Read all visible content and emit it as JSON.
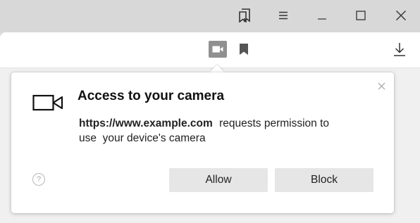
{
  "window": {
    "controls": [
      {
        "name": "bookmarks-panel-icon"
      },
      {
        "name": "menu-icon"
      },
      {
        "name": "minimize-icon"
      },
      {
        "name": "maximize-icon"
      },
      {
        "name": "close-window-icon"
      }
    ]
  },
  "toolbar": {
    "icons": [
      "camera-active-icon",
      "bookmark-icon",
      "download-icon"
    ]
  },
  "permission_popup": {
    "title": "Access to your camera",
    "site": "https://www.example.com",
    "message_line1": "requests permission to",
    "message_line2": "use  your device's camera",
    "help_glyph": "?",
    "allow_label": "Allow",
    "block_label": "Block"
  }
}
